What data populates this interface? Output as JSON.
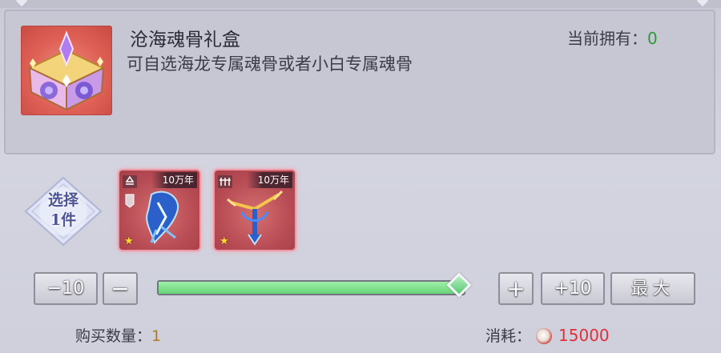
{
  "item": {
    "name": "沧海魂骨礼盒",
    "description": "可自选海龙专属魂骨或者小白专属魂骨",
    "owned_label": "当前拥有：",
    "owned_value": "0",
    "icon": "gift-chest-icon"
  },
  "select": {
    "line1": "选择",
    "line2": "1件"
  },
  "options": [
    {
      "age": "10万年",
      "stars": "★",
      "icon": "soul-bone-blue-icon"
    },
    {
      "age": "10万年",
      "stars": "★",
      "icon": "soul-bone-trident-icon"
    }
  ],
  "controls": {
    "minus10": "−10",
    "minus": "−",
    "plus": "+",
    "plus10": "+10",
    "max": "最大",
    "slider_fraction": 1.0
  },
  "purchase": {
    "qty_label": "购买数量：",
    "qty_value": "1",
    "cost_label": "消耗：",
    "cost_value": "15000",
    "currency_icon": "soul-coin-icon"
  },
  "colors": {
    "owned_green": "#2f9a3c",
    "cost_red": "#e0313a",
    "qty_gold": "#b8781d",
    "slider_green": "#67d37a"
  }
}
